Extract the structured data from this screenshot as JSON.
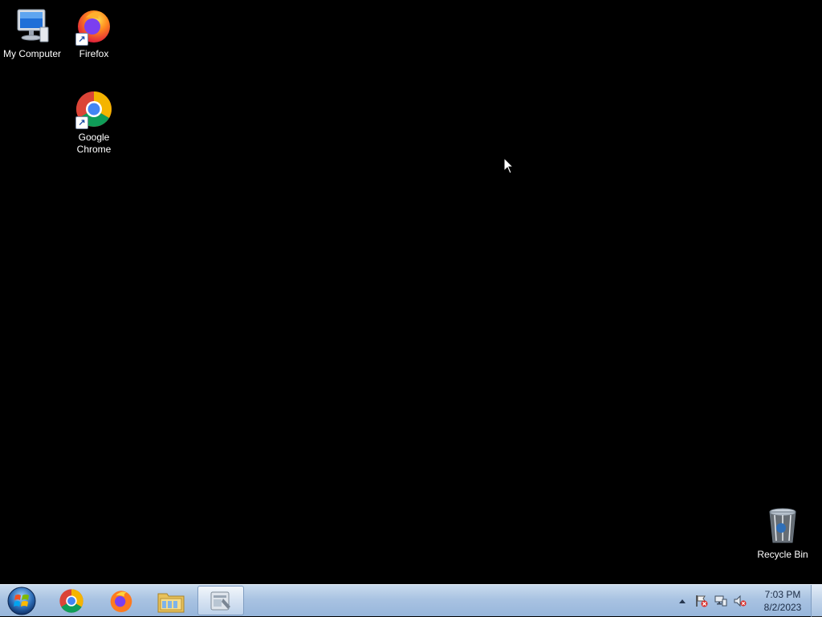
{
  "desktop": {
    "icons": [
      {
        "label": "My Computer",
        "icon": "computer-icon"
      },
      {
        "label": "Firefox",
        "icon": "firefox-icon"
      },
      {
        "label": "Google Chrome",
        "icon": "chrome-icon"
      },
      {
        "label": "Recycle Bin",
        "icon": "recycle-bin-icon"
      }
    ]
  },
  "taskbar": {
    "start_icon": "windows-start-orb",
    "pinned": [
      {
        "icon": "chrome-icon"
      },
      {
        "icon": "firefox-icon"
      },
      {
        "icon": "file-explorer-icon"
      },
      {
        "icon": "control-panel-icon",
        "active": true
      }
    ],
    "tray": {
      "icons": [
        "show-hidden-icons-arrow",
        "action-center-flag-icon",
        "network-icon",
        "volume-muted-icon"
      ],
      "time": "7:03 PM",
      "date": "8/2/2023"
    }
  },
  "colors": {
    "desktop_background": "#000000",
    "taskbar": "#a9c3e2"
  }
}
